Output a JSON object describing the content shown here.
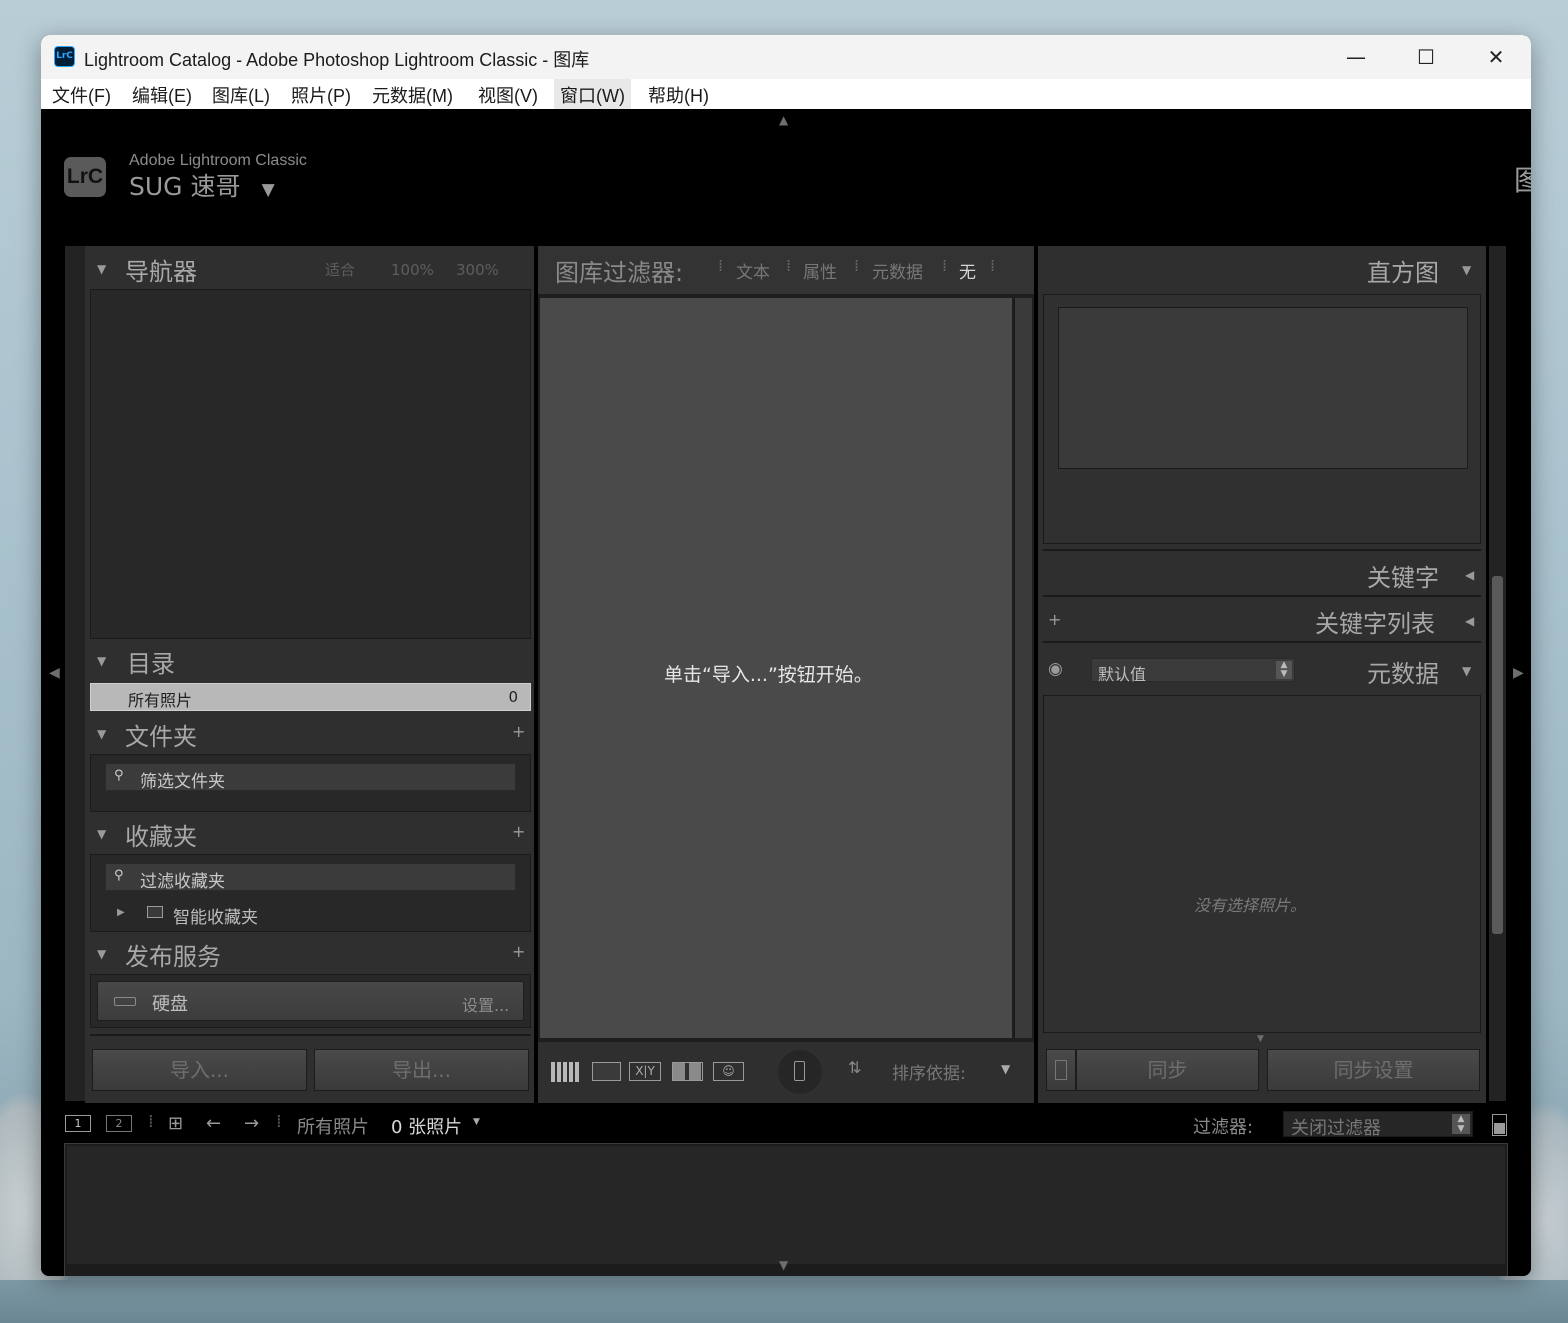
{
  "window": {
    "icon_label": "LrC",
    "title": "Lightroom Catalog - Adobe Photoshop Lightroom Classic - 图库",
    "minimize_glyph": "—",
    "maximize_glyph": "☐",
    "close_glyph": "✕"
  },
  "menu": {
    "items": [
      "文件(F)",
      "编辑(E)",
      "图库(L)",
      "照片(P)",
      "元数据(M)",
      "视图(V)",
      "窗口(W)",
      "帮助(H)"
    ]
  },
  "identity": {
    "logo": "LrC",
    "product": "Adobe Lightroom Classic",
    "user": "SUG 速哥",
    "edge_label": "图"
  },
  "left_panel": {
    "navigator": {
      "title": "导航器",
      "zoom_options": [
        "适合",
        "100%",
        "300%"
      ]
    },
    "catalog": {
      "title": "目录",
      "all_photos_label": "所有照片",
      "all_photos_count": "0"
    },
    "folders": {
      "title": "文件夹",
      "filter_placeholder": "筛选文件夹"
    },
    "collections": {
      "title": "收藏夹",
      "filter_placeholder": "过滤收藏夹",
      "smart_collections": "智能收藏夹"
    },
    "publish": {
      "title": "发布服务",
      "hard_disk": "硬盘",
      "setup": "设置..."
    },
    "import_button": "导入...",
    "export_button": "导出..."
  },
  "center": {
    "filter_bar": {
      "label": "图库过滤器:",
      "options": [
        "文本",
        "属性",
        "元数据",
        "无"
      ],
      "active": "无"
    },
    "empty_message": "单击“导入...”按钮开始。",
    "toolbar": {
      "sort_label": "排序依据:"
    }
  },
  "right_panel": {
    "histogram": {
      "title": "直方图"
    },
    "keywording": {
      "title": "关键字"
    },
    "keyword_list": {
      "title": "关键字列表"
    },
    "metadata": {
      "title": "元数据",
      "preset": "默认值",
      "empty": "没有选择照片。"
    },
    "sync_button": "同步",
    "sync_settings_button": "同步设置"
  },
  "filmstrip": {
    "page1": "1",
    "page2": "2",
    "source": "所有照片",
    "count": "0 张照片",
    "filter_label": "过滤器:",
    "filter_value": "关闭过滤器"
  },
  "icons": {
    "grid_view": "grid-icon",
    "loupe_view": "loupe-icon",
    "compare_view": "compare-icon",
    "survey_view": "survey-icon",
    "people_view": "people-icon",
    "spray": "spray-can-icon",
    "sort": "sort-icon",
    "eye": "eye-icon"
  },
  "colors": {
    "titlebar": "#f3f3f3",
    "background": "#000000",
    "panel": "#2f2f2f",
    "selected_row": "#b8b8b8",
    "center_bg": "#4a4a4a"
  }
}
